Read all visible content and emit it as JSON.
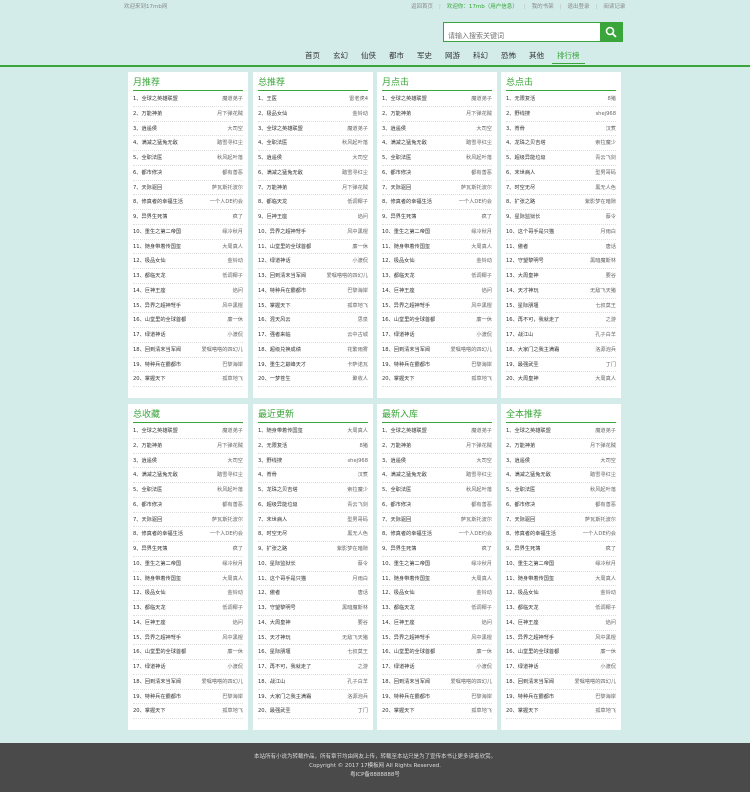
{
  "topbar": {
    "welcome": "欢迎来到17mb网",
    "home": "返回首页",
    "greeting": "欢迎你：17mb（用户信息）",
    "bookshelf": "我的书架",
    "logout": "退出登录",
    "history": "阅读记录"
  },
  "search": {
    "placeholder": "请输入搜索关键词"
  },
  "nav": [
    "首页",
    "玄幻",
    "仙侠",
    "都市",
    "军史",
    "网游",
    "科幻",
    "恐怖",
    "其他",
    "排行榜"
  ],
  "panels": [
    {
      "title": "月推荐",
      "items": [
        [
          "1、全球之英雄联盟",
          "魔道弟子"
        ],
        [
          "2、万能神弟",
          "月下弹花贼"
        ],
        [
          "3、逍遥侯",
          "大司空"
        ],
        [
          "4、满减之猛兔无敌",
          "踏雪寻红尘"
        ],
        [
          "5、全职法医",
          "秋风起叶落"
        ],
        [
          "6、都市修决",
          "都有善恶"
        ],
        [
          "7、天际驱回",
          "萨瓦斯托波尔"
        ],
        [
          "8、修真者的幸福生活",
          "一个人DE约会"
        ],
        [
          "9、异界生死簿",
          "疯了"
        ],
        [
          "10、重生之第二帝国",
          "缘冷秋月"
        ],
        [
          "11、随身带着传国玺",
          "大周真人"
        ],
        [
          "12、极品女仙",
          "金铃动"
        ],
        [
          "13、都临天龙",
          "低调椰子"
        ],
        [
          "14、巨神王座",
          "焰问"
        ],
        [
          "15、异界之超神弩手",
          "风中黑棍"
        ],
        [
          "16、山堂里的全球首都",
          "廉一休"
        ],
        [
          "17、绿道神话",
          "小渡侃"
        ],
        [
          "18、回到清末当军阀",
          "爱嘱嗒嗒的四幻儿"
        ],
        [
          "19、特种兵在霸都市",
          "巴黎海岸"
        ],
        [
          "20、掌握天下",
          "孤草地飞"
        ]
      ]
    },
    {
      "title": "总推荐",
      "items": [
        [
          "1、王医",
          "雷老虎4"
        ],
        [
          "2、极品女仙",
          "金铃动"
        ],
        [
          "3、全球之英雄联盟",
          "魔道弟子"
        ],
        [
          "4、全职法医",
          "秋风起叶落"
        ],
        [
          "5、逍遥侯",
          "大司空"
        ],
        [
          "6、满减之猛兔无敌",
          "踏雪寻红尘"
        ],
        [
          "7、万能神弟",
          "月下弹花贼"
        ],
        [
          "8、都临天龙",
          "低调椰子"
        ],
        [
          "9、巨神王座",
          "焰问"
        ],
        [
          "10、异界之超神弩手",
          "风中黑棍"
        ],
        [
          "11、山堂里的全球首都",
          "廉一休"
        ],
        [
          "12、绿道神话",
          "小渡侃"
        ],
        [
          "13、回到清末当军阀",
          "爱嘱嗒嗒的四幻儿"
        ],
        [
          "14、特种兵在霸都市",
          "巴黎海岸"
        ],
        [
          "15、掌握天下",
          "孤草地飞"
        ],
        [
          "16、混天风云",
          "思泉"
        ],
        [
          "17、强者来临",
          "云中古城"
        ],
        [
          "18、超级兑换成绩",
          "花繁雨雾"
        ],
        [
          "19、重生之巅峰天才",
          "卡萨诺瓦"
        ],
        [
          "20、一梦苍生",
          "聚收人"
        ]
      ]
    },
    {
      "title": "月点击",
      "items": [
        [
          "1、全球之英雄联盟",
          "魔道弟子"
        ],
        [
          "2、万能神弟",
          "月下弹花贼"
        ],
        [
          "3、逍遥侯",
          "大司空"
        ],
        [
          "4、满减之猛兔无敌",
          "踏雪寻红尘"
        ],
        [
          "5、全职法医",
          "秋风起叶落"
        ],
        [
          "6、都市修决",
          "都有善恶"
        ],
        [
          "7、天际驱回",
          "萨瓦斯托波尔"
        ],
        [
          "8、修真者的幸福生活",
          "一个人DE约会"
        ],
        [
          "9、异界生死簿",
          "疯了"
        ],
        [
          "10、重生之第二帝国",
          "缘冷秋月"
        ],
        [
          "11、随身带着传国玺",
          "大周真人"
        ],
        [
          "12、极品女仙",
          "金铃动"
        ],
        [
          "13、都临天龙",
          "低调椰子"
        ],
        [
          "14、巨神王座",
          "焰问"
        ],
        [
          "15、异界之超神弩手",
          "风中黑棍"
        ],
        [
          "16、山堂里的全球首都",
          "廉一休"
        ],
        [
          "17、绿道神话",
          "小渡侃"
        ],
        [
          "18、回到清末当军阀",
          "爱嘱嗒嗒的四幻儿"
        ],
        [
          "19、特种兵在霸都市",
          "巴黎海岸"
        ],
        [
          "20、掌握天下",
          "孤草地飞"
        ]
      ]
    },
    {
      "title": "总点击",
      "items": [
        [
          "1、无限复活",
          "8猪"
        ],
        [
          "2、野线搜",
          "shej968"
        ],
        [
          "3、脊骨",
          "汉煮"
        ],
        [
          "4、龙珠之贝吉塔",
          "索拉魔少"
        ],
        [
          "5、超级异能垃圾",
          "青云飞剑"
        ],
        [
          "6、末世病人",
          "型男哥码"
        ],
        [
          "7、时空无尽",
          "黑无人色"
        ],
        [
          "8、扩张之路",
          "紫影梦在暗隙"
        ],
        [
          "9、星际监狱长",
          "蔡令"
        ],
        [
          "10、这个哥手是只猫",
          "月雨白"
        ],
        [
          "11、傲者",
          "唐话"
        ],
        [
          "12、守望黎明号",
          "黑暗魔斯林"
        ],
        [
          "13、大周皇神",
          "要谷"
        ],
        [
          "14、天才神玩",
          "无敌飞天猪"
        ],
        [
          "15、星际朋堰",
          "七叔莫王"
        ],
        [
          "16、再不可，我就走了",
          "之游"
        ],
        [
          "17、战江山",
          "孔子白羊"
        ],
        [
          "18、大家门之我主满霜",
          "洛源泡兵"
        ],
        [
          "19、最强武圣",
          "丁门"
        ],
        [
          "20、大周皇神",
          "大周真人"
        ]
      ]
    },
    {
      "title": "总收藏",
      "items": [
        [
          "1、全球之英雄联盟",
          "魔道弟子"
        ],
        [
          "2、万能神弟",
          "月下弹花贼"
        ],
        [
          "3、逍遥侯",
          "大司空"
        ],
        [
          "4、满减之猛兔无敌",
          "踏雪寻红尘"
        ],
        [
          "5、全职法医",
          "秋风起叶落"
        ],
        [
          "6、都市修决",
          "都有善恶"
        ],
        [
          "7、天际驱回",
          "萨瓦斯托波尔"
        ],
        [
          "8、修真者的幸福生活",
          "一个人DE约会"
        ],
        [
          "9、异界生死簿",
          "疯了"
        ],
        [
          "10、重生之第二帝国",
          "缘冷秋月"
        ],
        [
          "11、随身带着传国玺",
          "大周真人"
        ],
        [
          "12、极品女仙",
          "金铃动"
        ],
        [
          "13、都临天龙",
          "低调椰子"
        ],
        [
          "14、巨神王座",
          "焰问"
        ],
        [
          "15、异界之超神弩手",
          "风中黑棍"
        ],
        [
          "16、山堂里的全球首都",
          "廉一休"
        ],
        [
          "17、绿道神话",
          "小渡侃"
        ],
        [
          "18、回到清末当军阀",
          "爱嘱嗒嗒的四幻儿"
        ],
        [
          "19、特种兵在霸都市",
          "巴黎海岸"
        ],
        [
          "20、掌握天下",
          "孤草地飞"
        ]
      ]
    },
    {
      "title": "最近更新",
      "items": [
        [
          "1、随身带着传国玺",
          "大周真人"
        ],
        [
          "2、无限复活",
          "8猪"
        ],
        [
          "3、野线搜",
          "shej968"
        ],
        [
          "4、脊骨",
          "汉煮"
        ],
        [
          "5、龙珠之贝吉塔",
          "索拉魔少"
        ],
        [
          "6、超级异能垃圾",
          "青云飞剑"
        ],
        [
          "7、末世病人",
          "型男哥码"
        ],
        [
          "8、时空无尽",
          "黑无人色"
        ],
        [
          "9、扩张之路",
          "紫影梦在暗隙"
        ],
        [
          "10、星际监狱长",
          "蔡令"
        ],
        [
          "11、这个哥手是只猫",
          "月雨白"
        ],
        [
          "12、傲者",
          "唐话"
        ],
        [
          "13、守望黎明号",
          "黑暗魔斯林"
        ],
        [
          "14、大周皇神",
          "要谷"
        ],
        [
          "15、天才神玩",
          "无敌飞天猪"
        ],
        [
          "16、星际朋堰",
          "七叔莫王"
        ],
        [
          "17、再不可，我就走了",
          "之游"
        ],
        [
          "18、战江山",
          "孔子白羊"
        ],
        [
          "19、大家门之我主满霜",
          "洛源泡兵"
        ],
        [
          "20、最强武圣",
          "丁门"
        ]
      ]
    },
    {
      "title": "最新入库",
      "items": [
        [
          "1、全球之英雄联盟",
          "魔道弟子"
        ],
        [
          "2、万能神弟",
          "月下弹花贼"
        ],
        [
          "3、逍遥侯",
          "大司空"
        ],
        [
          "4、满减之猛兔无敌",
          "踏雪寻红尘"
        ],
        [
          "5、全职法医",
          "秋风起叶落"
        ],
        [
          "6、都市修决",
          "都有善恶"
        ],
        [
          "7、天际驱回",
          "萨瓦斯托波尔"
        ],
        [
          "8、修真者的幸福生活",
          "一个人DE约会"
        ],
        [
          "9、异界生死簿",
          "疯了"
        ],
        [
          "10、重生之第二帝国",
          "缘冷秋月"
        ],
        [
          "11、随身带着传国玺",
          "大周真人"
        ],
        [
          "12、极品女仙",
          "金铃动"
        ],
        [
          "13、都临天龙",
          "低调椰子"
        ],
        [
          "14、巨神王座",
          "焰问"
        ],
        [
          "15、异界之超神弩手",
          "风中黑棍"
        ],
        [
          "16、山堂里的全球首都",
          "廉一休"
        ],
        [
          "17、绿道神话",
          "小渡侃"
        ],
        [
          "18、回到清末当军阀",
          "爱嘱嗒嗒的四幻儿"
        ],
        [
          "19、特种兵在霸都市",
          "巴黎海岸"
        ],
        [
          "20、掌握天下",
          "孤草地飞"
        ]
      ]
    },
    {
      "title": "全本推荐",
      "items": [
        [
          "1、全球之英雄联盟",
          "魔道弟子"
        ],
        [
          "2、万能神弟",
          "月下弹花贼"
        ],
        [
          "3、逍遥侯",
          "大司空"
        ],
        [
          "4、满减之猛兔无敌",
          "踏雪寻红尘"
        ],
        [
          "5、全职法医",
          "秋风起叶落"
        ],
        [
          "6、都市修决",
          "都有善恶"
        ],
        [
          "7、天际驱回",
          "萨瓦斯托波尔"
        ],
        [
          "8、修真者的幸福生活",
          "一个人DE约会"
        ],
        [
          "9、异界生死簿",
          "疯了"
        ],
        [
          "10、重生之第二帝国",
          "缘冷秋月"
        ],
        [
          "11、随身带着传国玺",
          "大周真人"
        ],
        [
          "12、极品女仙",
          "金铃动"
        ],
        [
          "13、都临天龙",
          "低调椰子"
        ],
        [
          "14、巨神王座",
          "焰问"
        ],
        [
          "15、异界之超神弩手",
          "风中黑棍"
        ],
        [
          "16、山堂里的全球首都",
          "廉一休"
        ],
        [
          "17、绿道神话",
          "小渡侃"
        ],
        [
          "18、回到清末当军阀",
          "爱嘱嗒嗒的四幻儿"
        ],
        [
          "19、特种兵在霸都市",
          "巴黎海岸"
        ],
        [
          "20、掌握天下",
          "孤草地飞"
        ]
      ]
    }
  ],
  "footer": {
    "line1": "本站所有小说为转载作品，所有章节均由网友上传，转载至本站只是为了宣传本书让更多读者欣赏。",
    "line2": "Copyright © 2017 17模板网 All Rights Reserved.",
    "line3": "粤ICP备8888888号"
  }
}
